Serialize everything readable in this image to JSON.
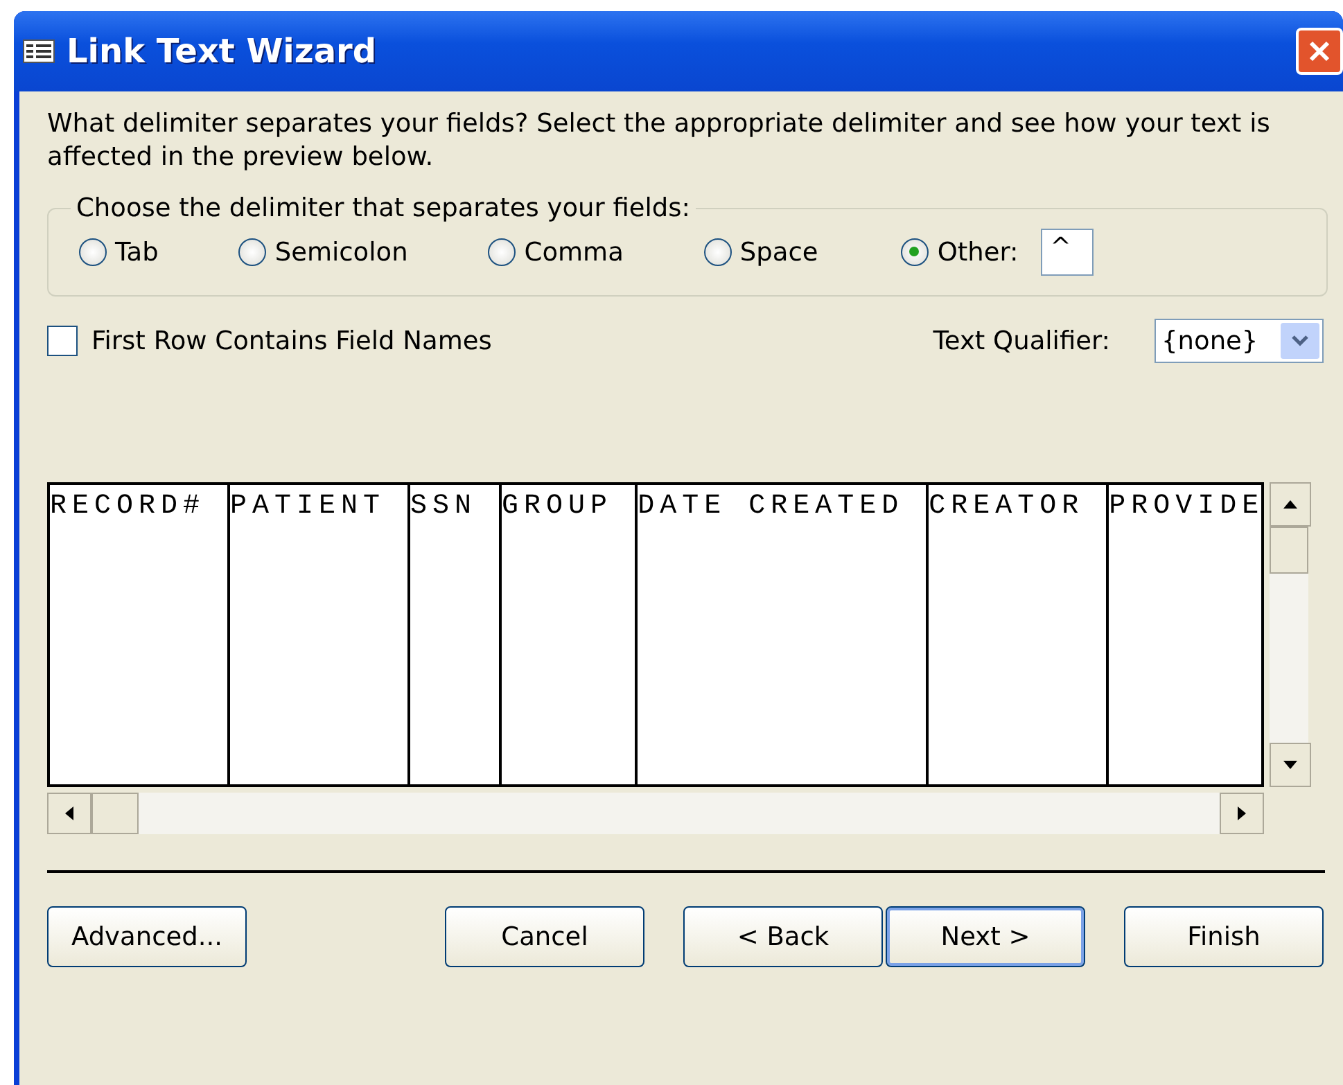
{
  "window": {
    "title": "Link Text Wizard"
  },
  "instructions": "What delimiter separates your fields? Select the appropriate delimiter and see how your text is affected in the preview below.",
  "delimiter_group": {
    "legend": "Choose the delimiter that separates your fields:",
    "options": [
      {
        "label": "Tab",
        "selected": false
      },
      {
        "label": "Semicolon",
        "selected": false
      },
      {
        "label": "Comma",
        "selected": false
      },
      {
        "label": "Space",
        "selected": false
      },
      {
        "label": "Other:",
        "selected": true
      }
    ],
    "other_value": "^"
  },
  "first_row_checkbox": {
    "label": "First Row Contains Field Names",
    "checked": false
  },
  "text_qualifier": {
    "label": "Text Qualifier:",
    "value": "{none}"
  },
  "preview": {
    "columns": [
      "RECORD#",
      "PATIENT",
      "SSN",
      "GROUP",
      "DATE CREATED",
      "CREATOR",
      "PROVIDE"
    ]
  },
  "buttons": [
    {
      "label": "Advanced...",
      "default": false
    },
    {
      "label": "Cancel",
      "default": false
    },
    {
      "label": "< Back",
      "default": false
    },
    {
      "label": "Next >",
      "default": true
    },
    {
      "label": "Finish",
      "default": false
    }
  ]
}
